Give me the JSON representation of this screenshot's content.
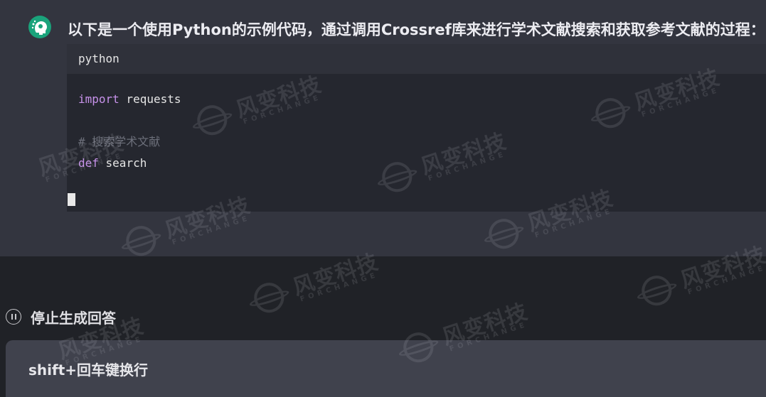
{
  "message": {
    "intro_text": "以下是一个使用Python的示例代码，通过调用Crossref库来进行学术文献搜索和获取参考文献的过程："
  },
  "code_block": {
    "language": "python",
    "lines": [
      {
        "keyword": "import",
        "text": " requests"
      },
      {
        "comment": "# 搜索学术文献"
      },
      {
        "keyword": "def",
        "text": " search"
      }
    ]
  },
  "controls": {
    "stop_label": "停止生成回答",
    "input_placeholder": "shift+回车键换行"
  },
  "watermark": {
    "title": "风变科技",
    "subtitle": "FORCHANGE"
  },
  "colors": {
    "avatar": "#1aa37b",
    "keyword": "#c792ea",
    "comment": "#6c6f7a"
  }
}
